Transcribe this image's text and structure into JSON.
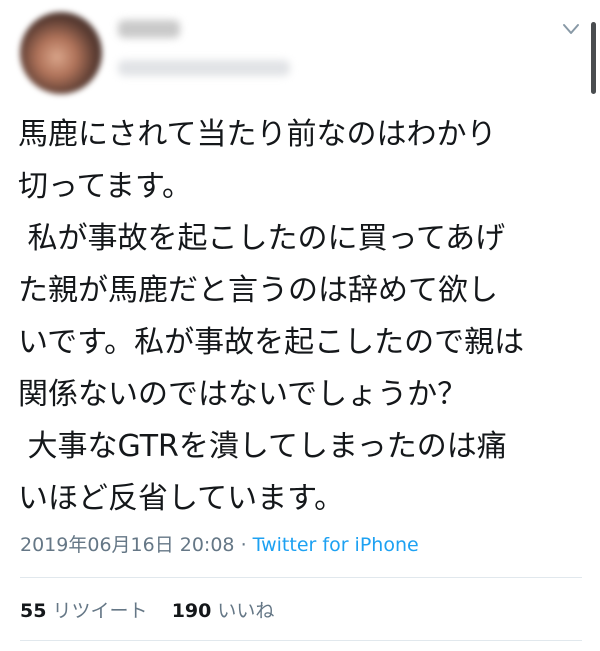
{
  "tweet": {
    "lines": [
      "馬鹿にされて当たり前なのはわかり",
      "切ってます。",
      " 私が事故を起こしたのに買ってあげ",
      "た親が馬鹿だと言うのは辞めて欲し",
      "いです。私が事故を起こしたので親は",
      "関係ないのではないでしょうか？",
      " 大事なGTRを潰してしまったのは痛",
      "いほど反省しています。"
    ],
    "timestamp": "2019年06月16日 20:08",
    "separator": "·",
    "source": "Twitter for iPhone"
  },
  "stats": {
    "retweets_count": "55",
    "retweets_label": "リツイート",
    "likes_count": "190",
    "likes_label": "いいね"
  },
  "icons": {
    "menu": "chevron-down-icon"
  },
  "colors": {
    "text": "#14171a",
    "muted": "#657786",
    "link": "#1da1f2",
    "divider": "#e1e8ed"
  }
}
